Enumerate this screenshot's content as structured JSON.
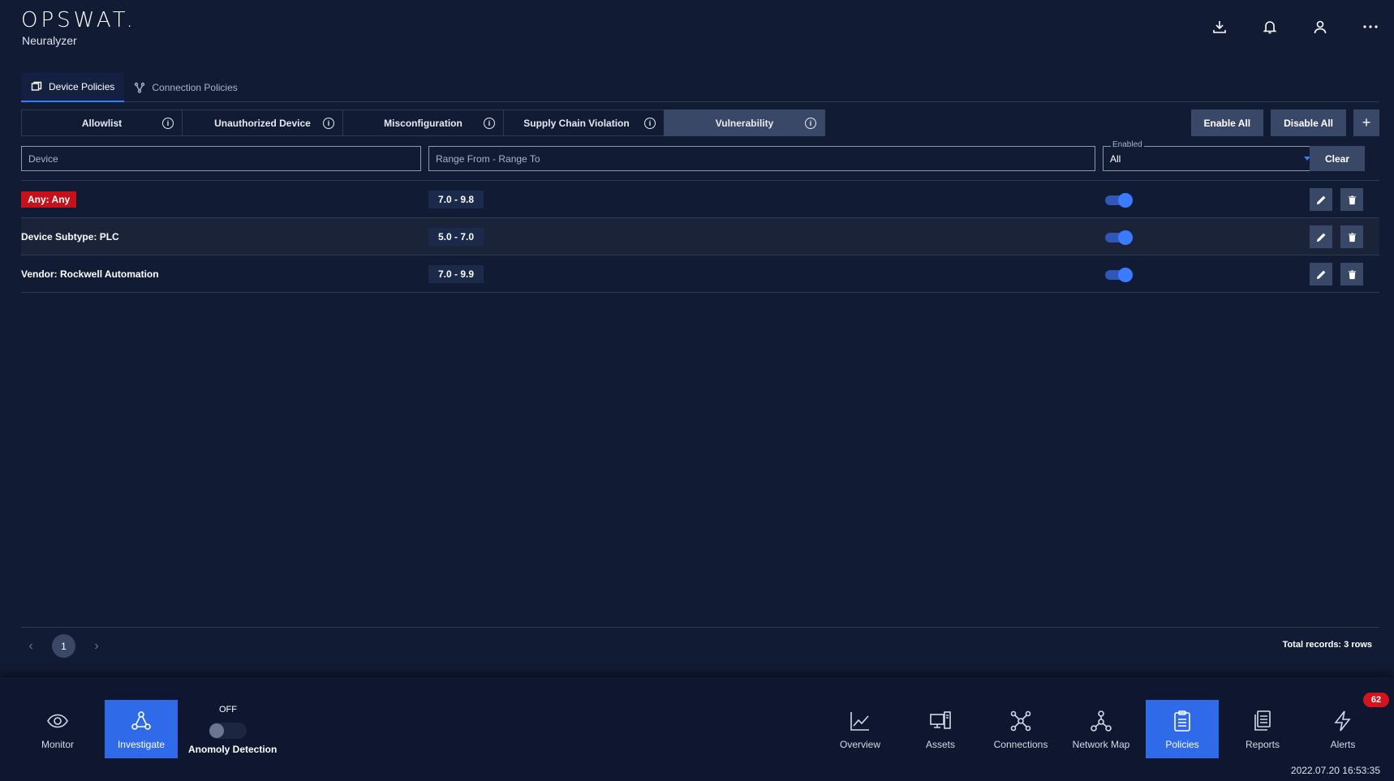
{
  "header": {
    "logo": "OPSWAT.",
    "product": "Neuralyzer",
    "icons": [
      "download-icon",
      "bell-icon",
      "user-icon",
      "more-icon"
    ]
  },
  "tabs": [
    {
      "label": "Device Policies",
      "icon": "device-icon",
      "active": true
    },
    {
      "label": "Connection Policies",
      "icon": "connection-icon",
      "active": false
    }
  ],
  "segments": [
    {
      "label": "Allowlist",
      "active": false
    },
    {
      "label": "Unauthorized Device",
      "active": false
    },
    {
      "label": "Misconfiguration",
      "active": false
    },
    {
      "label": "Supply Chain Violation",
      "active": false
    },
    {
      "label": "Vulnerability",
      "active": true
    }
  ],
  "actions": {
    "enable_all": "Enable All",
    "disable_all": "Disable All",
    "add": "+"
  },
  "filters": {
    "device_placeholder": "Device",
    "range_placeholder": "Range From - Range To",
    "enabled_label": "Enabled",
    "enabled_value": "All",
    "clear": "Clear"
  },
  "rows": [
    {
      "device": "Any: Any",
      "range": "7.0 - 9.8",
      "enabled": true
    },
    {
      "device": "Device Subtype: PLC",
      "range": "5.0 - 7.0",
      "enabled": true
    },
    {
      "device": "Vendor: Rockwell Automation",
      "range": "7.0 - 9.9",
      "enabled": true
    }
  ],
  "pagination": {
    "current_page": "1",
    "total": "Total records: 3 rows"
  },
  "bottom_nav": {
    "monitor": "Monitor",
    "investigate": "Investigate",
    "anomaly_state": "OFF",
    "anomaly_label": "Anomoly Detection",
    "overview": "Overview",
    "assets": "Assets",
    "connections": "Connections",
    "network_map": "Network Map",
    "policies": "Policies",
    "reports": "Reports",
    "alerts": "Alerts",
    "alerts_badge": "62",
    "datetime": "2022.07.20 16:53:35"
  },
  "colors": {
    "background": "#111b33",
    "accent": "#3a7bff",
    "active_nav": "#2f6be8",
    "button": "#3a4867",
    "danger": "#c4121c"
  }
}
